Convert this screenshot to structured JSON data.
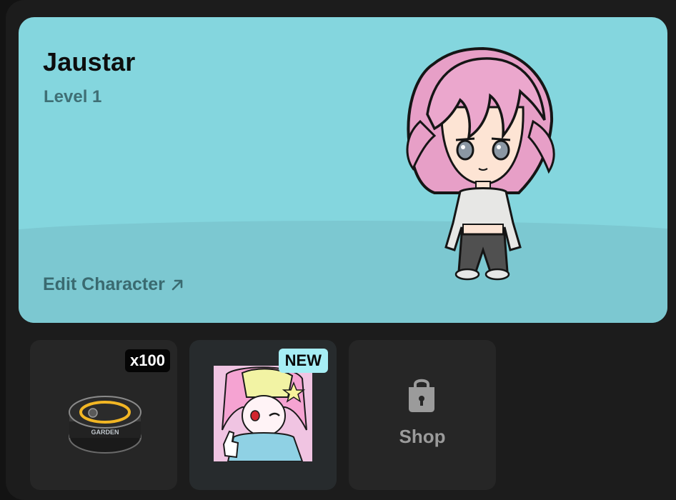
{
  "profile": {
    "name": "Jaustar",
    "level": "Level 1",
    "edit_label": "Edit Character"
  },
  "inventory": {
    "items": [
      {
        "kind": "can",
        "badge": "x100"
      },
      {
        "kind": "sticker",
        "badge": "NEW"
      }
    ],
    "shop_label": "Shop"
  },
  "colors": {
    "hero_bg": "#84d6de",
    "new_badge": "#a6eef5",
    "muted_text": "#3f6f75"
  }
}
